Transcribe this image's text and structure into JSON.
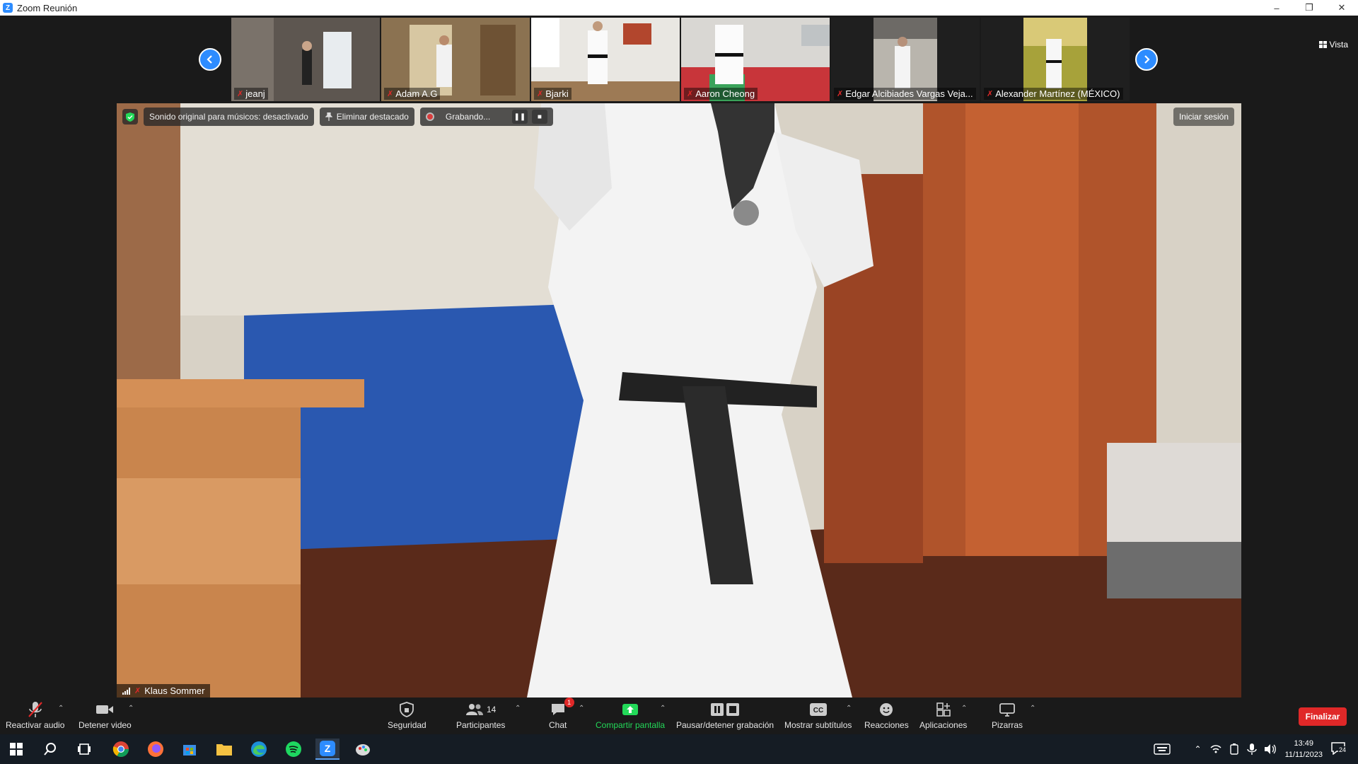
{
  "window": {
    "title": "Zoom Reunión",
    "controls": [
      "–",
      "❐",
      "✕"
    ]
  },
  "gallery": {
    "view_label": "Vista",
    "participants": [
      {
        "name": "jeanj"
      },
      {
        "name": "Adam A.G"
      },
      {
        "name": "Bjarki"
      },
      {
        "name": "Aaron Cheong"
      },
      {
        "name": "Edgar Alcibiades Vargas Veja..."
      },
      {
        "name": "Alexander Martínez (MÉXICO)"
      }
    ]
  },
  "main": {
    "original_sound": "Sonido original para músicos: desactivado",
    "remove_spotlight": "Eliminar destacado",
    "recording": "Grabando...",
    "sign_in": "Iniciar sesión",
    "speaker_name": "Klaus Sommer"
  },
  "toolbar": {
    "unmute": "Reactivar audio",
    "stop_video": "Detener video",
    "security": "Seguridad",
    "participants": "Participantes",
    "participants_count": "14",
    "chat": "Chat",
    "chat_badge": "1",
    "share": "Compartir pantalla",
    "pause_recording": "Pausar/detener grabación",
    "captions": "Mostrar subtítulos",
    "reactions": "Reacciones",
    "apps": "Aplicaciones",
    "whiteboards": "Pizarras",
    "end": "Finalizar"
  },
  "taskbar": {
    "time": "13:49",
    "date": "11/11/2023",
    "notifications": "24"
  },
  "colors": {
    "accent": "#2d8cff",
    "share_green": "#23d959",
    "danger": "#e02828"
  }
}
